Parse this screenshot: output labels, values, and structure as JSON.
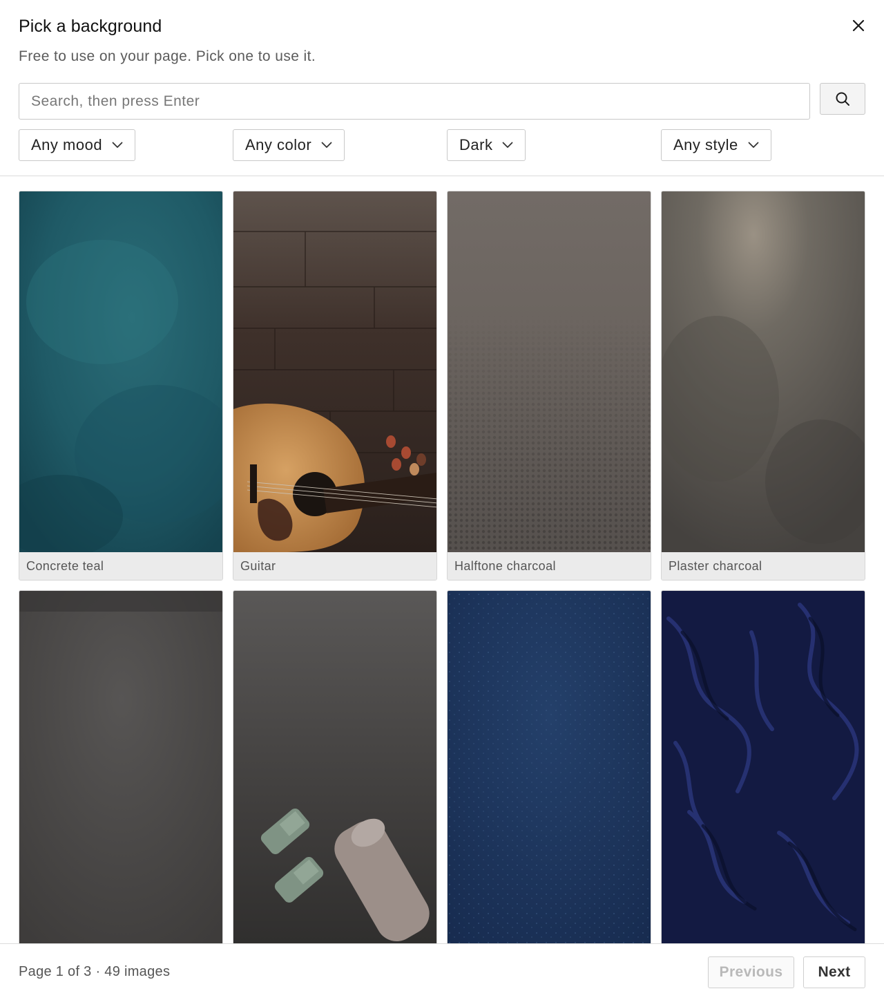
{
  "dialog": {
    "title": "Pick a background",
    "subtitle": "Free to use on your page. Pick one to use it."
  },
  "search": {
    "placeholder": "Search, then press Enter",
    "value": ""
  },
  "filters": [
    {
      "label": "Any mood"
    },
    {
      "label": "Any color"
    },
    {
      "label": "Dark"
    },
    {
      "label": "Any style"
    }
  ],
  "images": [
    {
      "caption": "Concrete teal",
      "color": "#1d5661"
    },
    {
      "caption": "Guitar",
      "color": "#3b2e28"
    },
    {
      "caption": "Halftone charcoal",
      "color": "#6b645f"
    },
    {
      "caption": "Plaster charcoal",
      "color": "#5b5650"
    },
    {
      "caption": "",
      "color": "#4a4846"
    },
    {
      "caption": "",
      "color": "#3d3b3a"
    },
    {
      "caption": "",
      "color": "#1b3257"
    },
    {
      "caption": "",
      "color": "#141c44"
    }
  ],
  "pagination": {
    "info": "Page 1 of 3 · 49 images",
    "previous_label": "Previous",
    "next_label": "Next",
    "previous_disabled": true
  },
  "icons": {
    "close": "close-icon",
    "search": "search-icon",
    "chevron": "chevron-down-icon"
  }
}
